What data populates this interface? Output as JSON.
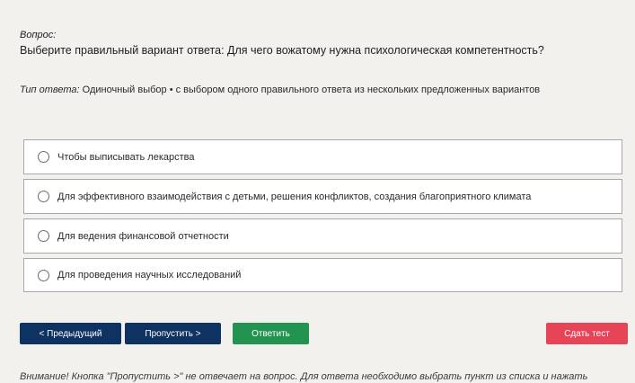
{
  "question": {
    "heading": "Вопрос:",
    "text": "Выберите правильный вариант ответа: Для чего вожатому нужна психологическая компетентность?"
  },
  "answer_type": {
    "label": "Тип ответа:",
    "value": "Одиночный выбор • с выбором одного правильного ответа из нескольких предложенных вариантов"
  },
  "options": [
    {
      "label": "Чтобы выписывать лекарства",
      "selected": false
    },
    {
      "label": "Для эффективного взаимодействия с детьми, решения конфликтов, создания благоприятного климата",
      "selected": false
    },
    {
      "label": "Для ведения финансовой отчетности",
      "selected": false
    },
    {
      "label": "Для проведения научных исследований",
      "selected": false
    }
  ],
  "buttons": {
    "prev": "< Предыдущий",
    "skip": "Пропустить >",
    "answer": "Ответить",
    "finish": "Сдать тест"
  },
  "warning": "Внимание! Кнопка \"Пропустить >\" не отвечает на вопрос. Для ответа необходимо выбрать пункт из списка и нажать",
  "colors": {
    "background": "#f3f1ee",
    "nav_button": "#0e3362",
    "answer_button": "#23944f",
    "finish_button": "#e84457"
  }
}
